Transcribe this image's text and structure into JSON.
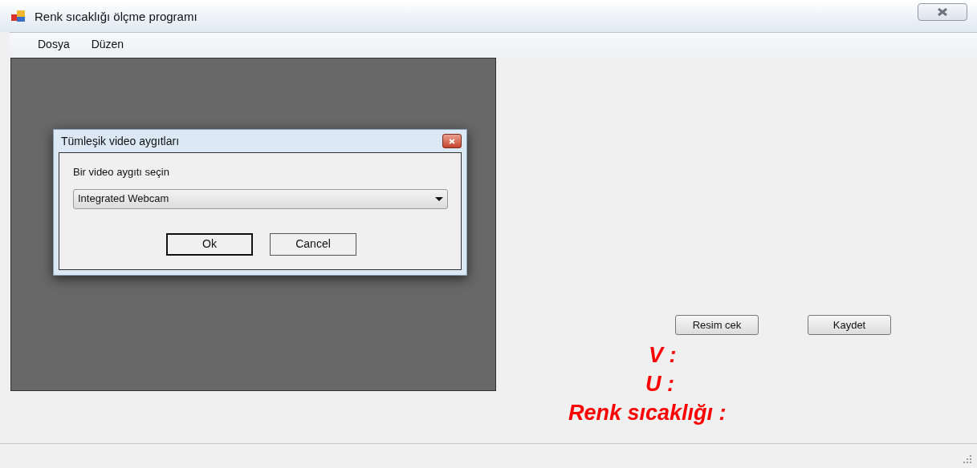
{
  "window": {
    "title": "Renk sıcaklığı ölçme programı"
  },
  "menu": [
    {
      "label": "Dosya"
    },
    {
      "label": "Düzen"
    }
  ],
  "dialog": {
    "title": "Tümleşik video aygıtları",
    "prompt": "Bir video aygıtı seçin",
    "device": {
      "value": "Integrated Webcam"
    },
    "buttons": [
      {
        "label": "Ok",
        "default": true
      },
      {
        "label": "Cancel",
        "default": false
      }
    ]
  },
  "buttons": [
    "Resim cek",
    "Kaydet"
  ],
  "readings": [
    {
      "label": "V :"
    },
    {
      "label": "U :"
    },
    {
      "label": "Renk sıcaklığı :"
    }
  ]
}
